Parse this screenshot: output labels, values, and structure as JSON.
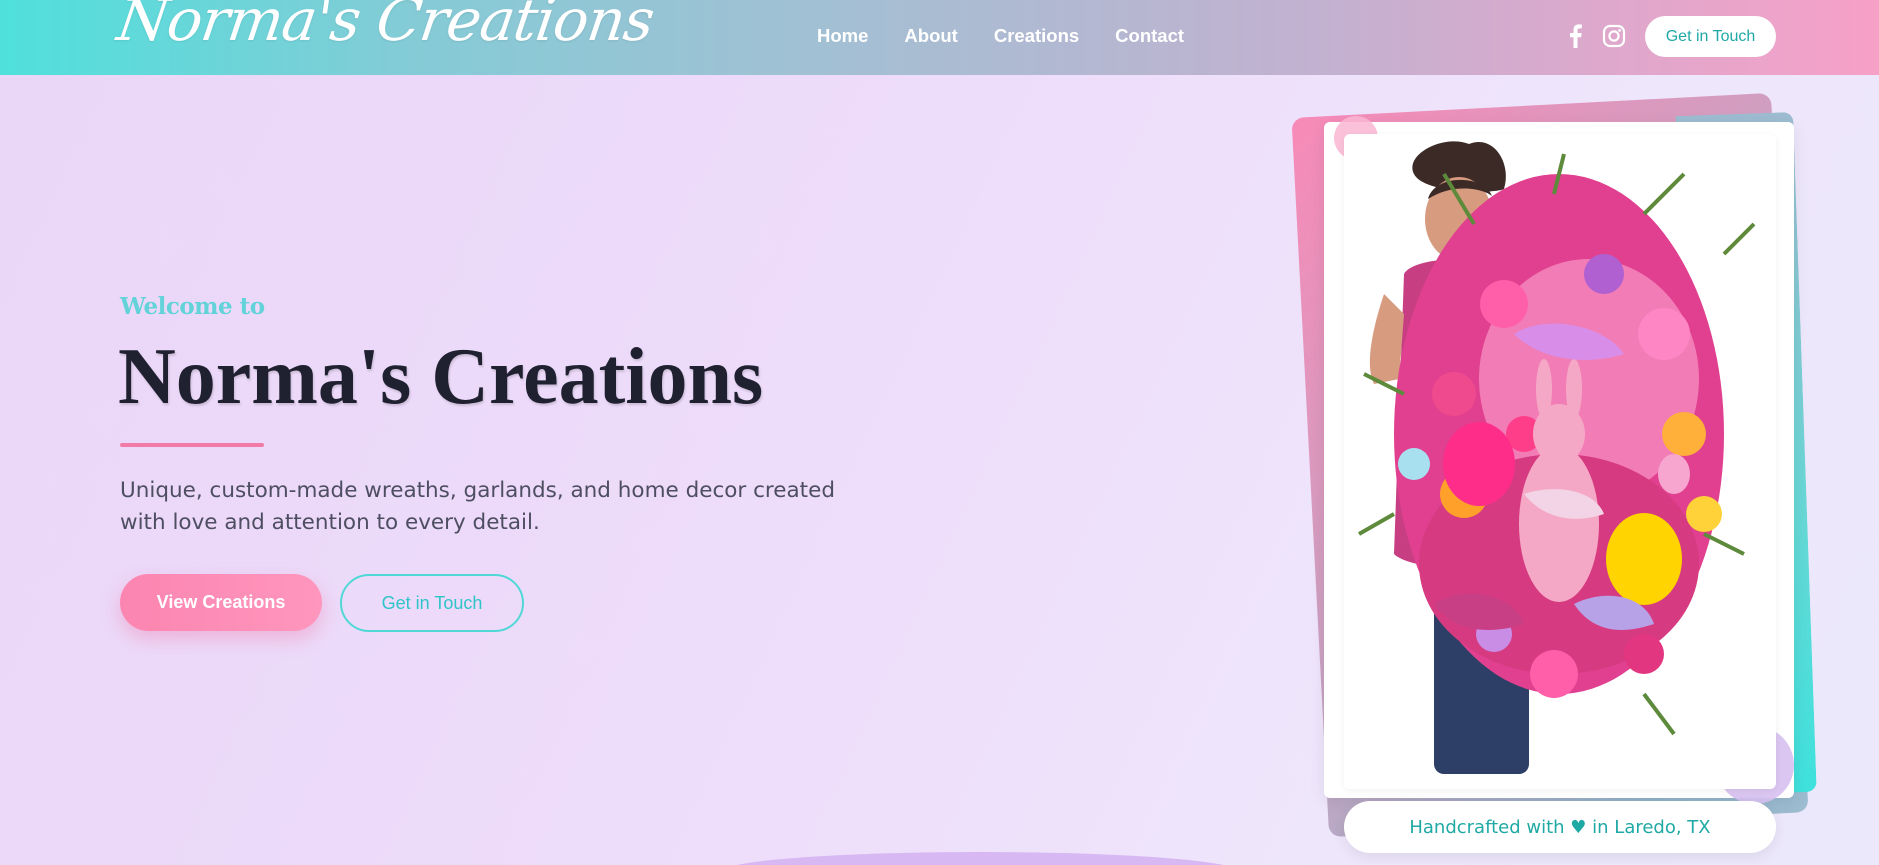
{
  "header": {
    "logo_text": "Norma's Creations",
    "nav": [
      "Home",
      "About",
      "Creations",
      "Contact"
    ],
    "social_icons": [
      "facebook-icon",
      "instagram-icon"
    ],
    "cta_label": "Get in Touch"
  },
  "hero": {
    "welcome": "Welcome to",
    "title": "Norma's Creations",
    "subtitle": "Unique, custom-made wreaths, garlands, and home decor created with love and attention to every detail.",
    "primary_button": "View Creations",
    "secondary_button": "Get in Touch",
    "caption": "Handcrafted with ♥ in Laredo, TX"
  },
  "colors": {
    "header_gradient": [
      "#4fe0dc",
      "#f7a0c8"
    ],
    "accent_pink": "#ff8ab4",
    "accent_teal": "#2fc4c8",
    "title": "#1f2030",
    "background": "#eedcfb"
  }
}
